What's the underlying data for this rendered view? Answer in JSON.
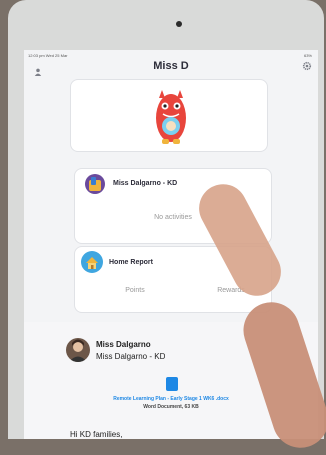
{
  "status": {
    "time_date": "12:03 pm  Wed 25 Mar",
    "battery": "63%"
  },
  "header": {
    "title": "Miss D"
  },
  "class_card": {
    "name": "Miss Dalgarno - KD",
    "subtitle": "No activities"
  },
  "report_card": {
    "title": "Home Report",
    "points_label": "Points",
    "rewards_label": "Rewards"
  },
  "post": {
    "author_name": "Miss Dalgarno",
    "author_class": "Miss Dalgarno - KD",
    "attachment_title": "Remote Learning Plan - Early Stage 1 WK6 .docx",
    "attachment_meta": "Word Document, 63 KB",
    "body": "Hi KD families,"
  },
  "colors": {
    "accent": "#1e88e5",
    "title_text": "#2d2d3a",
    "monster_red": "#e8453c"
  },
  "icons": [
    "person-icon",
    "gear-icon",
    "monster-icon",
    "house-icon",
    "doc-icon"
  ]
}
